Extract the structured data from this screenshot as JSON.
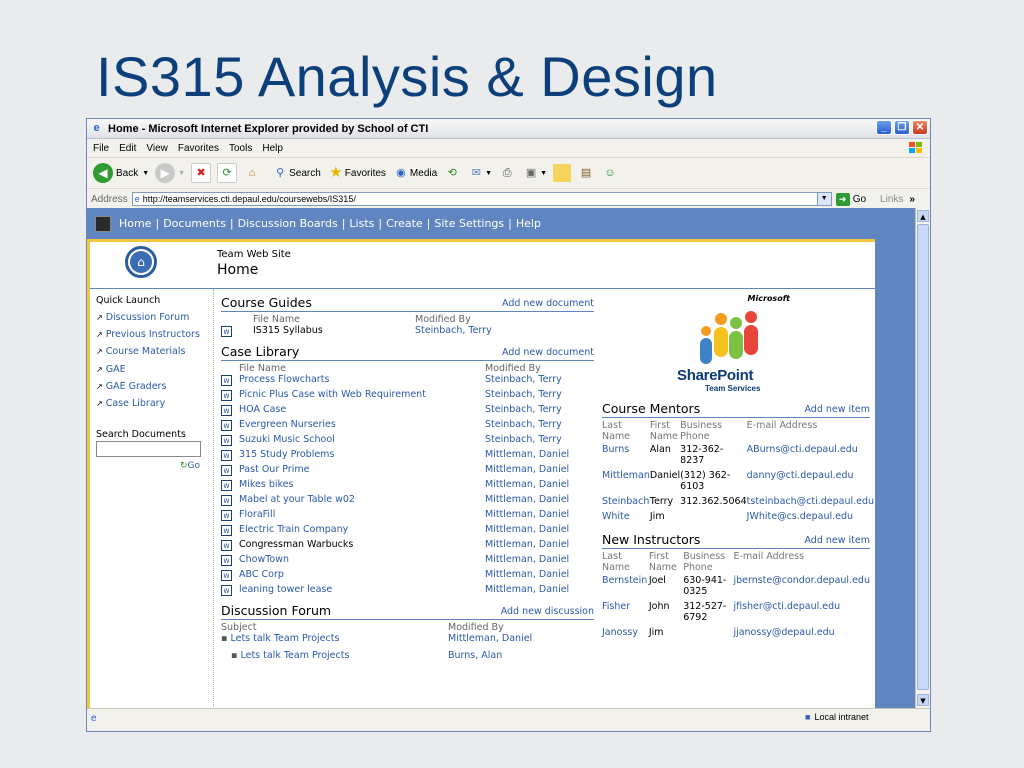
{
  "slide": {
    "title": "IS315 Analysis & Design"
  },
  "window": {
    "title": "Home - Microsoft Internet Explorer provided by School of CTI"
  },
  "menu": [
    "File",
    "Edit",
    "View",
    "Favorites",
    "Tools",
    "Help"
  ],
  "toolbar": {
    "back": "Back",
    "search": "Search",
    "favorites": "Favorites",
    "media": "Media"
  },
  "address": {
    "label": "Address",
    "url": "http://teamservices.cti.depaul.edu/coursewebs/IS315/",
    "go": "Go",
    "links": "Links"
  },
  "nav": {
    "items": [
      "Home",
      "Documents",
      "Discussion Boards",
      "Lists",
      "Create",
      "Site Settings",
      "Help"
    ],
    "separator": "|"
  },
  "header": {
    "site_name": "Team Web Site",
    "page_title": "Home"
  },
  "quick_launch": {
    "title": "Quick Launch",
    "items": [
      "Discussion Forum",
      "Previous Instructors",
      "Course Materials",
      "GAE",
      "GAE Graders",
      "Case Library"
    ],
    "search_title": "Search Documents",
    "search_go": "Go"
  },
  "course_guides": {
    "title": "Course Guides",
    "add": "Add new document",
    "col_name": "File Name",
    "col_mod": "Modified By",
    "rows": [
      {
        "name": "IS315 Syllabus",
        "mod": "Steinbach, Terry"
      }
    ]
  },
  "case_library": {
    "title": "Case Library",
    "add": "Add new document",
    "col_name": "File Name",
    "col_mod": "Modified By",
    "rows": [
      {
        "name": "Process Flowcharts",
        "mod": "Steinbach, Terry"
      },
      {
        "name": "Picnic Plus Case with Web Requirement",
        "mod": "Steinbach, Terry"
      },
      {
        "name": "HOA Case",
        "mod": "Steinbach, Terry"
      },
      {
        "name": "Evergreen Nurseries",
        "mod": "Steinbach, Terry"
      },
      {
        "name": "Suzuki Music School",
        "mod": "Steinbach, Terry"
      },
      {
        "name": "315 Study Problems",
        "mod": "Mittleman, Daniel"
      },
      {
        "name": "Past Our Prime",
        "mod": "Mittleman, Daniel"
      },
      {
        "name": "Mikes bikes",
        "mod": "Mittleman, Daniel"
      },
      {
        "name": "Mabel at your Table w02",
        "mod": "Mittleman, Daniel"
      },
      {
        "name": "FloraFill",
        "mod": "Mittleman, Daniel"
      },
      {
        "name": "Electric Train Company",
        "mod": "Mittleman, Daniel"
      },
      {
        "name": "Congressman Warbucks",
        "mod": "Mittleman, Daniel"
      },
      {
        "name": "ChowTown",
        "mod": "Mittleman, Daniel"
      },
      {
        "name": "ABC Corp",
        "mod": "Mittleman, Daniel"
      },
      {
        "name": "leaning tower lease",
        "mod": "Mittleman, Daniel"
      }
    ]
  },
  "discussion": {
    "title": "Discussion Forum",
    "add": "Add new discussion",
    "col_subject": "Subject",
    "col_mod": "Modified By",
    "rows": [
      {
        "subject": "Lets talk Team Projects",
        "mod": "Mittleman, Daniel"
      },
      {
        "subject": "Lets talk Team Projects",
        "mod": "Burns, Alan"
      }
    ]
  },
  "sharepoint": {
    "microsoft": "Microsoft",
    "name": "SharePoint",
    "sub": "Team Services"
  },
  "mentors": {
    "title": "Course Mentors",
    "add": "Add new item",
    "headers": [
      "Last Name",
      "First Name",
      "Business Phone",
      "E-mail Address"
    ],
    "rows": [
      {
        "last": "Burns",
        "first": "Alan",
        "phone": "312-362-8237",
        "email": "ABurns@cti.depaul.edu"
      },
      {
        "last": "Mittleman",
        "first": "Daniel",
        "phone": "(312) 362-6103",
        "email": "danny@cti.depaul.edu"
      },
      {
        "last": "Steinbach",
        "first": "Terry",
        "phone": "312.362.5064",
        "email": "tsteinbach@cti.depaul.edu"
      },
      {
        "last": "White",
        "first": "Jim",
        "phone": "",
        "email": "JWhite@cs.depaul.edu"
      }
    ]
  },
  "instructors": {
    "title": "New Instructors",
    "add": "Add new item",
    "headers": [
      "Last Name",
      "First Name",
      "Business Phone",
      "E-mail Address"
    ],
    "rows": [
      {
        "last": "Bernstein",
        "first": "Joel",
        "phone": "630-941-0325",
        "email": "jbernste@condor.depaul.edu"
      },
      {
        "last": "Fisher",
        "first": "John",
        "phone": "312-527-6792",
        "email": "jfisher@cti.depaul.edu"
      },
      {
        "last": "Janossy",
        "first": "Jim",
        "phone": "",
        "email": "jjanossy@depaul.edu"
      }
    ]
  },
  "status": {
    "zone": "Local intranet"
  },
  "colors": {
    "nav_blue": "#5f86c0",
    "link": "#2a5aa8",
    "title": "#0d3f7a",
    "accent": "#f3c63b"
  }
}
